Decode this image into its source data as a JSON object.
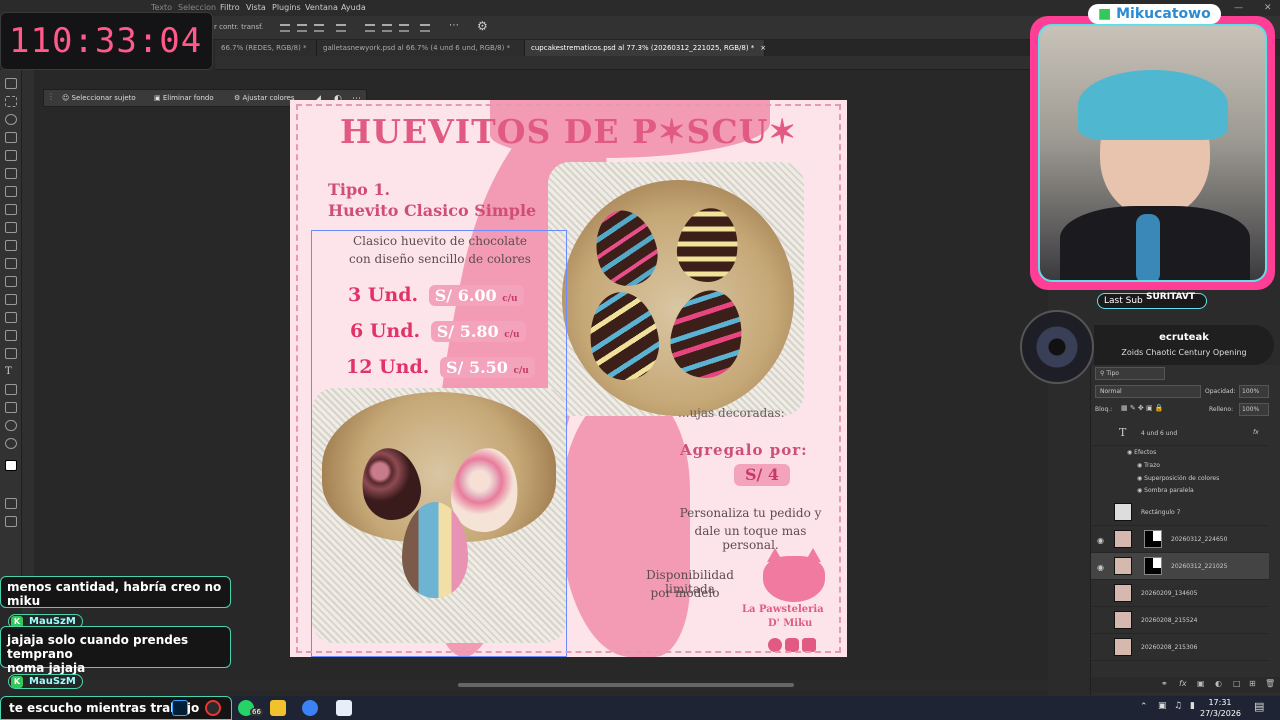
{
  "menu": {
    "items": [
      "Filtro",
      "Vista",
      "Plugins",
      "Ventana",
      "Ayuda"
    ],
    "hidden_items": [
      "Texto",
      "Seleccion"
    ]
  },
  "options_bar": {
    "label": "r contr. transf."
  },
  "tabs": [
    {
      "label": "66.7% (REDES, RGB/8) *",
      "active": false
    },
    {
      "label": "galletasnewyork.psd al 66.7% (4 und   6 und, RGB/8) *",
      "active": false
    },
    {
      "label": "cupcakestrematicos.psd al 77.3% (20260312_221025, RGB/8) *",
      "active": true
    }
  ],
  "contextual_bar": {
    "select_subject": "Seleccionar sujeto",
    "remove_bg": "Eliminar fondo",
    "adjust_colors": "Ajustar colores"
  },
  "document": {
    "title": "HUEVITOS DE P✶SCU✶",
    "type_heading_1": "Tipo 1.",
    "type_heading_2": "Huevito Clasico Simple",
    "desc_line1": "Clasico huevito de chocolate",
    "desc_line2": "con diseño sencillo de colores",
    "prices": [
      {
        "qty": "3 Und.",
        "price": "S/ 6.00",
        "unit": "c/u"
      },
      {
        "qty": "6 Und.",
        "price": "S/ 5.80",
        "unit": "c/u"
      },
      {
        "qty": "12 Und.",
        "price": "S/ 5.50",
        "unit": "c/u"
      }
    ],
    "partial_text": "...ujas decoradas:",
    "add_heading": "Agregalo por:",
    "add_price": "S/ 4",
    "personalize_1": "Personaliza tu pedido y",
    "personalize_2": "dale un toque mas personal.",
    "availability_1": "Disponibilidad limitada",
    "availability_2": "por modelo",
    "brand_1": "La Pawsteleria",
    "brand_2": "D' Miku",
    "social_icons": [
      "whatsapp-icon",
      "instagram-icon",
      "facebook-icon"
    ]
  },
  "timer": {
    "value": "110:33:04"
  },
  "stream": {
    "channel_title": "Mikucatowo",
    "last_sub_label": "Last Sub",
    "last_sub_name": "SURITAVT",
    "music_artist": "ecruteak",
    "music_title": "Zoids Chaotic Century Opening"
  },
  "layers_panel": {
    "filter_kind": "Tipo",
    "blend_mode": "Normal",
    "opacity_label": "Opacidad:",
    "opacity_value": "100%",
    "lock_label": "Bloq.:",
    "fill_label": "Relleno:",
    "fill_value": "100%",
    "layers": [
      {
        "name": "4 und   6 und",
        "kind": "text"
      },
      {
        "name": "Efectos",
        "kind": "effects"
      },
      {
        "name": "Trazo",
        "kind": "effect"
      },
      {
        "name": "Superposición de colores",
        "kind": "effect"
      },
      {
        "name": "Sombra paralela",
        "kind": "effect"
      },
      {
        "name": "Rectángulo 7",
        "kind": "shape"
      },
      {
        "name": "20260312_224650",
        "kind": "image-mask"
      },
      {
        "name": "20260312_221025",
        "kind": "image-mask",
        "selected": true
      },
      {
        "name": "20260209_134605",
        "kind": "image"
      },
      {
        "name": "20260208_215524",
        "kind": "image"
      },
      {
        "name": "20260208_215306",
        "kind": "image"
      }
    ]
  },
  "chat": {
    "messages": [
      {
        "user": "",
        "text": "menos cantidad, habría creo no\nmiku"
      },
      {
        "user": "MauSzM",
        "text": "jajaja solo cuando prendes temprano\nnoma jajaja"
      },
      {
        "user": "MauSzM",
        "text": "te escucho mientras trabajo"
      }
    ]
  },
  "taskbar": {
    "time": "17:31",
    "date": "27/3/2026",
    "whatsapp_badge": "66"
  },
  "colors": {
    "accent_pink": "#e05a83",
    "stream_pink": "#ff3f96",
    "chat_border": "#4bd3b0"
  }
}
